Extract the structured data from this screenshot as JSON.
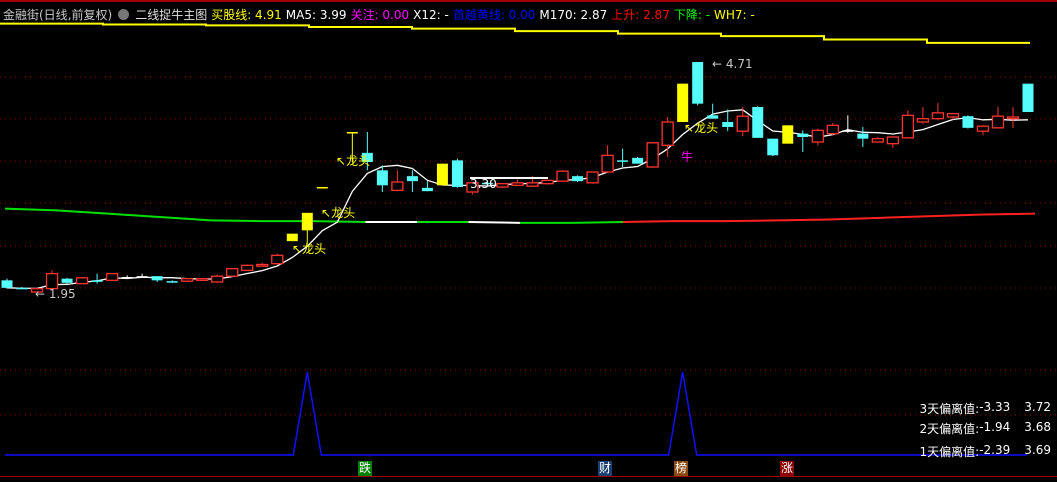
{
  "header": {
    "stock": "金融街(日线,前复权)",
    "indicator": "二线捉牛主图",
    "items": [
      {
        "label": "买股线: 4.91",
        "color": "#ffff00"
      },
      {
        "label": "MA5: 3.99",
        "color": "#ffffff"
      },
      {
        "label": "关注: 0.00",
        "color": "#ff00ff"
      },
      {
        "label": "X12: -",
        "color": "#ffffff"
      },
      {
        "label": "首越黄线: 0.00",
        "color": "#0000ff"
      },
      {
        "label": "M170: 2.87",
        "color": "#ffffff"
      },
      {
        "label": "上升: 2.87",
        "color": "#ff0000"
      },
      {
        "label": "下降: -",
        "color": "#00ff00"
      },
      {
        "label": "WH7: -",
        "color": "#ffff00"
      }
    ]
  },
  "annotations": {
    "high_label": "4.71",
    "low_label": "1.95",
    "mid_label": "3.30",
    "dragon": "龙头",
    "bull": "牛"
  },
  "colors": {
    "up": "#ff3232",
    "down": "#54fcfc",
    "signal": "#ffff00",
    "doji": "#ffffff"
  },
  "chart_data": {
    "type": "candlestick",
    "price_range": [
      1.95,
      4.71
    ],
    "candles": [
      [
        2.09,
        2.0,
        2.11,
        1.99,
        "d"
      ],
      [
        2.0,
        1.99,
        2.01,
        1.99,
        "d"
      ],
      [
        1.95,
        1.99,
        1.99,
        1.95,
        "u"
      ],
      [
        1.99,
        2.17,
        2.21,
        1.99,
        "u"
      ],
      [
        2.11,
        2.06,
        2.12,
        2.05,
        "d"
      ],
      [
        2.05,
        2.12,
        2.13,
        2.05,
        "u"
      ],
      [
        2.09,
        2.08,
        2.17,
        2.05,
        "d"
      ],
      [
        2.09,
        2.17,
        2.17,
        2.09,
        "u"
      ],
      [
        2.13,
        2.13,
        2.15,
        2.12,
        "w"
      ],
      [
        2.14,
        2.14,
        2.17,
        2.12,
        "w"
      ],
      [
        2.14,
        2.09,
        2.14,
        2.07,
        "d"
      ],
      [
        2.08,
        2.08,
        2.09,
        2.06,
        "d"
      ],
      [
        2.08,
        2.11,
        2.11,
        2.07,
        "u"
      ],
      [
        2.09,
        2.11,
        2.11,
        2.08,
        "u"
      ],
      [
        2.07,
        2.14,
        2.16,
        2.06,
        "u"
      ],
      [
        2.14,
        2.23,
        2.23,
        2.13,
        "u"
      ],
      [
        2.21,
        2.27,
        2.28,
        2.21,
        "u"
      ],
      [
        2.26,
        2.28,
        2.3,
        2.26,
        "u"
      ],
      [
        2.29,
        2.39,
        2.41,
        2.28,
        "u"
      ],
      [
        2.56,
        2.65,
        2.65,
        2.56,
        "y"
      ],
      [
        2.69,
        2.9,
        2.9,
        2.52,
        "y"
      ],
      [
        3.2,
        3.21,
        3.21,
        3.2,
        "y"
      ],
      null,
      [
        3.87,
        3.87,
        3.87,
        3.51,
        "y"
      ],
      [
        3.62,
        3.51,
        3.87,
        3.41,
        "d"
      ],
      [
        3.41,
        3.23,
        3.47,
        3.15,
        "d"
      ],
      [
        3.17,
        3.27,
        3.41,
        3.16,
        "u"
      ],
      [
        3.34,
        3.28,
        3.41,
        3.15,
        "d"
      ],
      [
        3.2,
        3.16,
        3.28,
        3.16,
        "d"
      ],
      [
        3.49,
        3.23,
        3.49,
        3.23,
        "y"
      ],
      [
        3.53,
        3.21,
        3.55,
        3.2,
        "d"
      ],
      [
        3.15,
        3.26,
        3.26,
        3.12,
        "u"
      ],
      [
        3.26,
        3.25,
        3.27,
        3.24,
        "d"
      ],
      [
        3.21,
        3.25,
        3.26,
        3.2,
        "u"
      ],
      [
        3.23,
        3.26,
        3.3,
        3.22,
        "u"
      ],
      [
        3.22,
        3.26,
        3.34,
        3.21,
        "u"
      ],
      [
        3.25,
        3.29,
        3.29,
        3.24,
        "u"
      ],
      [
        3.28,
        3.4,
        3.41,
        3.28,
        "u"
      ],
      [
        3.34,
        3.28,
        3.35,
        3.27,
        "d"
      ],
      [
        3.26,
        3.39,
        3.39,
        3.25,
        "u"
      ],
      [
        3.39,
        3.59,
        3.71,
        3.38,
        "u"
      ],
      [
        3.53,
        3.53,
        3.67,
        3.45,
        "d"
      ],
      [
        3.56,
        3.49,
        3.57,
        3.49,
        "d"
      ],
      [
        3.45,
        3.74,
        3.75,
        3.44,
        "u"
      ],
      [
        3.71,
        3.99,
        4.05,
        3.57,
        "u"
      ],
      [
        3.99,
        4.45,
        4.45,
        3.99,
        "y"
      ],
      [
        4.71,
        4.21,
        4.71,
        4.19,
        "d"
      ],
      [
        4.07,
        4.03,
        4.21,
        4.03,
        "d"
      ],
      [
        3.99,
        3.93,
        4.14,
        3.88,
        "d"
      ],
      [
        3.88,
        4.06,
        4.17,
        3.82,
        "u"
      ],
      [
        4.17,
        3.8,
        4.18,
        3.8,
        "d"
      ],
      [
        3.79,
        3.59,
        3.79,
        3.58,
        "d"
      ],
      [
        3.73,
        3.95,
        3.95,
        3.73,
        "y"
      ],
      [
        3.85,
        3.81,
        3.89,
        3.63,
        "d"
      ],
      [
        3.75,
        3.89,
        3.91,
        3.71,
        "u"
      ],
      [
        3.85,
        3.95,
        3.98,
        3.83,
        "u"
      ],
      [
        3.89,
        3.89,
        4.07,
        3.86,
        "w"
      ],
      [
        3.85,
        3.79,
        3.93,
        3.69,
        "d"
      ],
      [
        3.75,
        3.79,
        3.81,
        3.75,
        "u"
      ],
      [
        3.73,
        3.81,
        3.81,
        3.68,
        "u"
      ],
      [
        3.8,
        4.07,
        4.13,
        3.79,
        "u"
      ],
      [
        3.99,
        4.03,
        4.17,
        3.97,
        "u"
      ],
      [
        4.03,
        4.1,
        4.22,
        4.01,
        "u"
      ],
      [
        4.05,
        4.09,
        4.1,
        4.02,
        "u"
      ],
      [
        4.06,
        3.92,
        4.07,
        3.91,
        "d"
      ],
      [
        3.88,
        3.94,
        3.95,
        3.83,
        "u"
      ],
      [
        3.92,
        4.06,
        4.17,
        3.92,
        "u"
      ],
      [
        4.03,
        4.05,
        4.17,
        3.92,
        "u"
      ],
      [
        4.45,
        4.11,
        4.45,
        4.11,
        "d"
      ]
    ],
    "buy_line": [
      5.17,
      5.16,
      5.15,
      5.13,
      5.11,
      5.08,
      5.05,
      5.02,
      4.98,
      4.94
    ],
    "m170_line": {
      "values": [
        2.95,
        2.93,
        2.89,
        2.85,
        2.81,
        2.8,
        2.8,
        2.79,
        2.79,
        2.79,
        2.78,
        2.78,
        2.79,
        2.8,
        2.8,
        2.81,
        2.82,
        2.84,
        2.86,
        2.88,
        2.89
      ],
      "trend": [
        "down",
        "down",
        "down",
        "down",
        "down",
        "down",
        "down",
        "flat",
        "down",
        "flat",
        "down",
        "down",
        "up",
        "up",
        "up",
        "up",
        "up",
        "up",
        "up",
        "up",
        "up"
      ]
    },
    "signal_panel": {
      "values_at_candles": {
        "20": 1,
        "45": 1
      },
      "range": [
        0,
        1
      ]
    }
  },
  "deviation": [
    {
      "label": "3天偏离值:",
      "value": "-3.33",
      "price": "3.72"
    },
    {
      "label": "2天偏离值:",
      "value": "-1.94",
      "price": "3.68"
    },
    {
      "label": "1天偏离值:",
      "value": "-2.39",
      "price": "3.69"
    }
  ],
  "tags": [
    {
      "text": "跌",
      "color": "#008000"
    },
    {
      "text": "财",
      "color": "#1a3f70"
    },
    {
      "text": "榜",
      "color": "#8a4a10"
    },
    {
      "text": "涨",
      "color": "#8b0000"
    }
  ]
}
